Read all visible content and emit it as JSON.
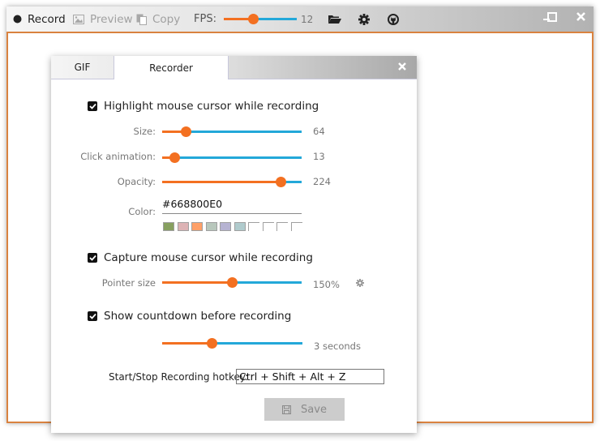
{
  "toolbar": {
    "record_label": "Record",
    "preview_label": "Preview",
    "copy_label": "Copy",
    "fps_label": "FPS:",
    "fps_value": "12",
    "fps_fraction": 0.4,
    "icons": [
      "record-dot-icon",
      "image-icon",
      "copy-icon",
      "folder-open-icon",
      "gear-icon",
      "github-icon"
    ]
  },
  "window_controls": {
    "minimize": "minimize-icon",
    "maximize": "maximize-icon",
    "close": "close-icon"
  },
  "colors": {
    "accent_orange": "#f37021",
    "accent_blue": "#23a8d9",
    "frame_border": "#d9823f"
  },
  "dialog": {
    "tabs": [
      {
        "label": "GIF",
        "active": false
      },
      {
        "label": "Recorder",
        "active": true
      }
    ],
    "highlight": {
      "checkbox_label": "Highlight mouse cursor while recording",
      "checked": true,
      "size_label": "Size:",
      "size_value": "64",
      "size_fraction": 0.17,
      "click_label": "Click animation:",
      "click_value": "13",
      "click_fraction": 0.09,
      "opacity_label": "Opacity:",
      "opacity_value": "224",
      "opacity_fraction": 0.85,
      "color_label": "Color:",
      "color_value": "#668800E0",
      "swatches": [
        "#87a060",
        "#ddb3b5",
        "#fea068",
        "#b8c7bc",
        "#b6b3d2",
        "#b0cbcd",
        "",
        "",
        "",
        ""
      ]
    },
    "capture": {
      "checkbox_label": "Capture mouse cursor while recording",
      "checked": true,
      "pointer_label": "Pointer size",
      "pointer_value": "150%",
      "pointer_fraction": 0.5
    },
    "countdown": {
      "checkbox_label": "Show countdown before recording",
      "checked": true,
      "value": "3 seconds",
      "fraction": 0.35
    },
    "hotkey": {
      "label": "Start/Stop Recording hotkey:",
      "value": "Ctrl + Shift + Alt + Z"
    },
    "save_label": "Save"
  }
}
